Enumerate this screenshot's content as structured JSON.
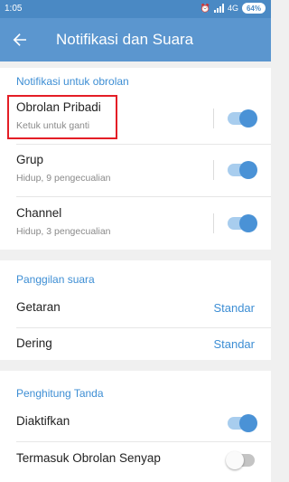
{
  "status_bar": {
    "time": "1:05",
    "network": "4G",
    "battery": "64%"
  },
  "app_bar": {
    "back_icon": "arrow-left-icon",
    "title": "Notifikasi dan Suara"
  },
  "chat_notifications": {
    "header": "Notifikasi untuk obrolan",
    "items": [
      {
        "label": "Obrolan Pribadi",
        "sublabel": "Ketuk untuk ganti",
        "enabled": true
      },
      {
        "label": "Grup",
        "sublabel": "Hidup, 9 pengecualian",
        "enabled": true
      },
      {
        "label": "Channel",
        "sublabel": "Hidup, 3 pengecualian",
        "enabled": true
      }
    ]
  },
  "voice_calls": {
    "header": "Panggilan suara",
    "items": [
      {
        "label": "Getaran",
        "value": "Standar"
      },
      {
        "label": "Dering",
        "value": "Standar"
      }
    ]
  },
  "badge_counter": {
    "header": "Penghitung Tanda",
    "items": [
      {
        "label": "Diaktifkan",
        "enabled": true
      },
      {
        "label": "Termasuk Obrolan Senyap",
        "enabled": false
      }
    ]
  },
  "colors": {
    "app_bar": "#5b96cf",
    "accent": "#3d8ed4",
    "highlight": "#e41e26"
  }
}
